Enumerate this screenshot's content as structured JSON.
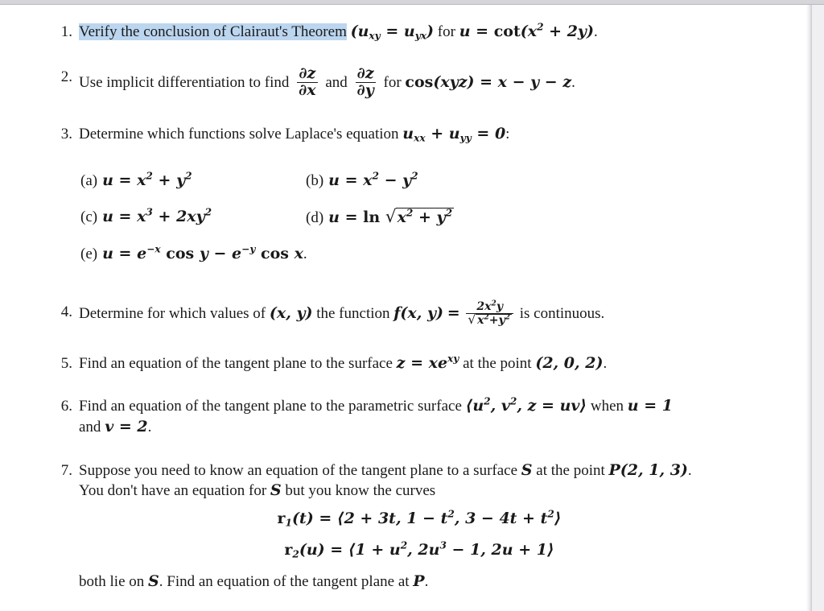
{
  "document": {
    "highlight_color": "#bcd6f0",
    "background_color": "#ffffff",
    "chrome_color": "#d6d6da"
  },
  "problems": [
    {
      "number": "1.",
      "highlighted_text": "Verify the conclusion of Clairaut's Theorem",
      "paren_open": "(",
      "u_sub_xy": "u",
      "sub_xy": "xy",
      "equals": "=",
      "u_sub_yx": "u",
      "sub_yx": "yx",
      "paren_close": ")",
      "for_word": "for",
      "u_var": "u",
      "eq2": "=",
      "cot": "cot",
      "arg_open": "(",
      "x_var": "x",
      "exp2": "2",
      "plus": "+",
      "two_y": "2y",
      "arg_close": ")",
      "period": "."
    },
    {
      "number": "2.",
      "lead": "Use implicit differentiation to find",
      "frac1_num": "∂z",
      "frac1_den": "∂x",
      "and_word": "and",
      "frac2_num": "∂z",
      "frac2_den": "∂y",
      "for_word": "for",
      "cos": "cos",
      "cos_arg": "(xyz)",
      "equals": "=",
      "rhs": "x − y − z",
      "period": "."
    },
    {
      "number": "3.",
      "lead": "Determine which functions solve Laplace's equation",
      "u1": "u",
      "sub1": "xx",
      "plus": "+",
      "u2": "u",
      "sub2": "yy",
      "equals": "=",
      "zero": "0",
      "colon": ":"
    },
    {
      "number": "4.",
      "lead": "Determine for which values of",
      "point": "(x, y)",
      "mid": "the function",
      "fxy": "f(x, y)",
      "equals": "=",
      "frac_num_pre": "2x",
      "frac_num_exp": "2",
      "frac_num_post": "y",
      "frac_den_pre": "x",
      "frac_den_exp1": "2",
      "frac_den_plus": "+y",
      "frac_den_exp2": "2",
      "tail": "is continuous."
    },
    {
      "number": "5.",
      "lead": "Find an equation of the tangent plane to the surface",
      "z_var": "z",
      "equals": "=",
      "xe": "xe",
      "exp": "xy",
      "mid": "at the point",
      "point": "(2, 0, 2)",
      "period": "."
    },
    {
      "number": "6.",
      "lead": "Find an equation of the tangent plane to the parametric surface",
      "vec_open": "⟨",
      "u_sq": "u",
      "u_exp": "2",
      "comma1": ",",
      "v_sq": "v",
      "v_exp": "2",
      "comma2": ",",
      "z_uv": "z = uv",
      "vec_close": "⟩",
      "when_word": "when",
      "u_eq": "u = 1",
      "line2_and": "and",
      "v_eq": "v = 2",
      "period": "."
    },
    {
      "number": "7.",
      "line1_a": "Suppose you need to know an equation of the tangent plane to a surface",
      "S1": "S",
      "line1_b": "at the point",
      "P_point": "P(2, 1, 3)",
      "line1_period": ".",
      "line2_a": "You don't have an equation for",
      "S2": "S",
      "line2_b": "but you know the curves",
      "eq1": {
        "name": "r",
        "sub": "1",
        "arg": "(t)",
        "equals": "=",
        "open": "⟨",
        "c1": "2 + 3t",
        "comma1": ",",
        "c2_pre": "1 − t",
        "c2_exp": "2",
        "comma2": ",",
        "c3_pre": "3 − 4t + t",
        "c3_exp": "2",
        "close": "⟩"
      },
      "eq2": {
        "name": "r",
        "sub": "2",
        "arg": "(u)",
        "equals": "=",
        "open": "⟨",
        "c1_pre": "1 + u",
        "c1_exp": "2",
        "comma1": ",",
        "c2_pre": "2u",
        "c2_exp": "3",
        "c2_post": " − 1",
        "comma2": ",",
        "c3": "2u + 1",
        "close": "⟩"
      },
      "line3_a": "both lie on",
      "S3": "S",
      "line3_b": ". Find an equation of the tangent plane at",
      "P3": "P",
      "line3_period": "."
    }
  ],
  "problem3_subparts": [
    {
      "label": "(a)",
      "u": "u",
      "equals": "=",
      "t1": "x",
      "t1_exp": "2",
      "op": "+",
      "t2": "y",
      "t2_exp": "2"
    },
    {
      "label": "(b)",
      "u": "u",
      "equals": "=",
      "t1": "x",
      "t1_exp": "2",
      "op": "−",
      "t2": "y",
      "t2_exp": "2"
    },
    {
      "label": "(c)",
      "u": "u",
      "equals": "=",
      "t1": "x",
      "t1_exp": "3",
      "op": "+",
      "t2": "2xy",
      "t2_exp": "2"
    },
    {
      "label": "(d)",
      "u": "u",
      "equals": "=",
      "ln": "ln",
      "rad_pre": "x",
      "rad_exp1": "2",
      "rad_plus": "+ y",
      "rad_exp2": "2"
    },
    {
      "label": "(e)",
      "u": "u",
      "equals": "=",
      "e1": "e",
      "e1_exp": "−x",
      "cos1": "cos",
      "v1": "y",
      "op": "−",
      "e2": "e",
      "e2_exp": "−y",
      "cos2": "cos",
      "v2": "x",
      "period": "."
    }
  ]
}
